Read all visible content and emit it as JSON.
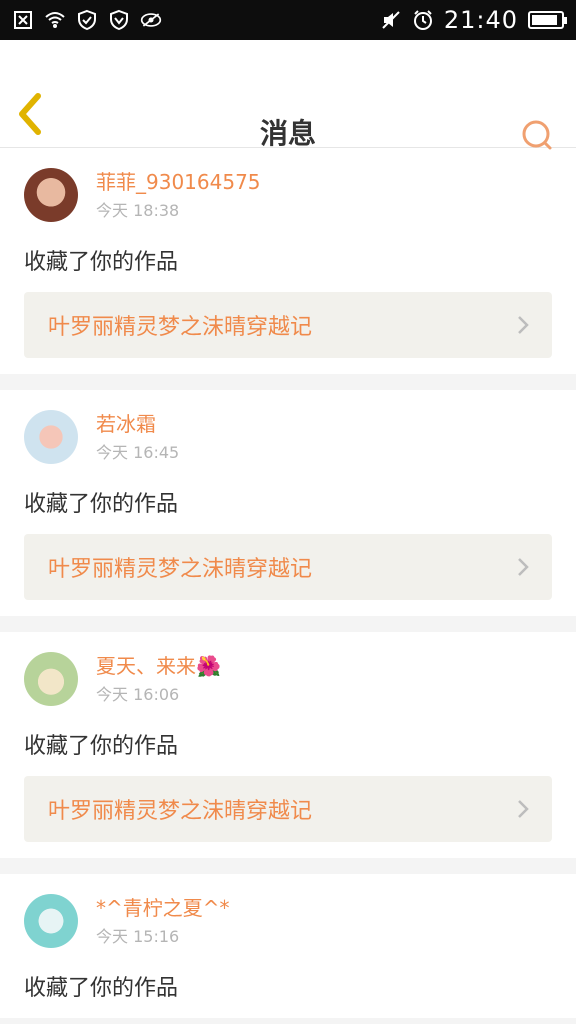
{
  "status_bar": {
    "time": "21:40",
    "battery_level": 0.9
  },
  "header": {
    "title": "消息"
  },
  "messages": [
    {
      "username": "菲菲_930164575",
      "time": "今天 18:38",
      "action": "收藏了你的作品",
      "work_title": "叶罗丽精灵梦之沫晴穿越记",
      "avatar_colors": [
        "#7a3b2a",
        "#e8b9a0"
      ]
    },
    {
      "username": "若冰霜",
      "time": "今天 16:45",
      "action": "收藏了你的作品",
      "work_title": "叶罗丽精灵梦之沫晴穿越记",
      "avatar_colors": [
        "#cfe3ef",
        "#f5c6b8"
      ]
    },
    {
      "username": "夏天、来来🌺",
      "time": "今天 16:06",
      "action": "收藏了你的作品",
      "work_title": "叶罗丽精灵梦之沫晴穿越记",
      "avatar_colors": [
        "#b7d39a",
        "#f2e6c8"
      ]
    },
    {
      "username": "*^青柠之夏^*",
      "time": "今天 15:16",
      "action": "收藏了你的作品",
      "work_title": "",
      "avatar_colors": [
        "#7fd3d0",
        "#e7f4f5"
      ]
    }
  ],
  "colors": {
    "accent": "#f08a4b",
    "back_arrow": "#e0b300",
    "search": "#f0a070"
  }
}
